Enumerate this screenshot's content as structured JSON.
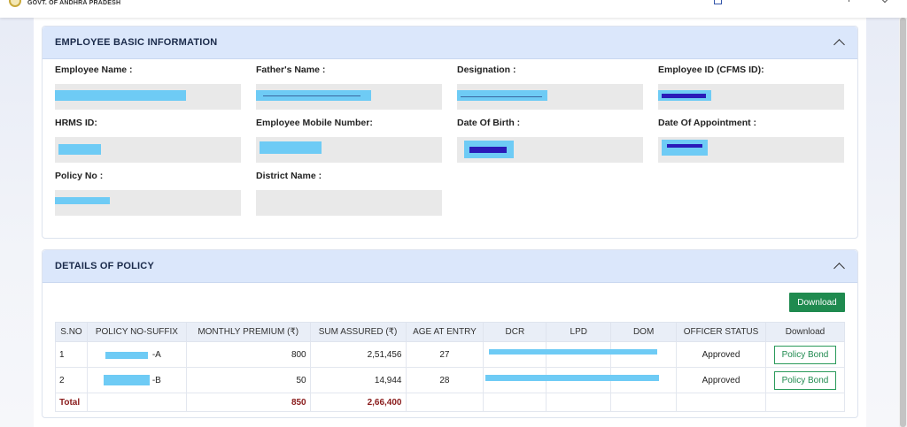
{
  "header": {
    "govt_name": "GOVT. OF ANDHRA PRADESH"
  },
  "basic_info": {
    "title": "EMPLOYEE BASIC INFORMATION",
    "fields": {
      "employee_name": "Employee Name :",
      "fathers_name": "Father's Name :",
      "designation": "Designation :",
      "employee_id": "Employee ID (CFMS ID):",
      "hrms_id": "HRMS ID:",
      "mobile": "Employee Mobile Number:",
      "dob": "Date Of Birth :",
      "doa": "Date Of Appointment :",
      "policy_no": "Policy No :",
      "district": "District Name :"
    }
  },
  "policy": {
    "title": "DETAILS OF POLICY",
    "download_label": "Download",
    "columns": [
      "S.NO",
      "POLICY NO-SUFFIX",
      "MONTHLY PREMIUM (₹)",
      "SUM ASSURED (₹)",
      "AGE AT ENTRY",
      "DCR",
      "LPD",
      "DOM",
      "OFFICER STATUS",
      "Download"
    ],
    "rows": [
      {
        "sno": "1",
        "suffix": "-A",
        "premium": "800",
        "sum": "2,51,456",
        "age": "27",
        "status": "Approved",
        "bond": "Policy Bond"
      },
      {
        "sno": "2",
        "suffix": "-B",
        "premium": "50",
        "sum": "14,944",
        "age": "28",
        "status": "Approved",
        "bond": "Policy Bond"
      }
    ],
    "total": {
      "label": "Total",
      "premium": "850",
      "sum": "2,66,400"
    }
  },
  "colors": {
    "header_bg": "#dbe7fb",
    "download_green": "#1f8a4f",
    "total_red": "#8a1c1c",
    "redaction": "#6ecbf5"
  }
}
